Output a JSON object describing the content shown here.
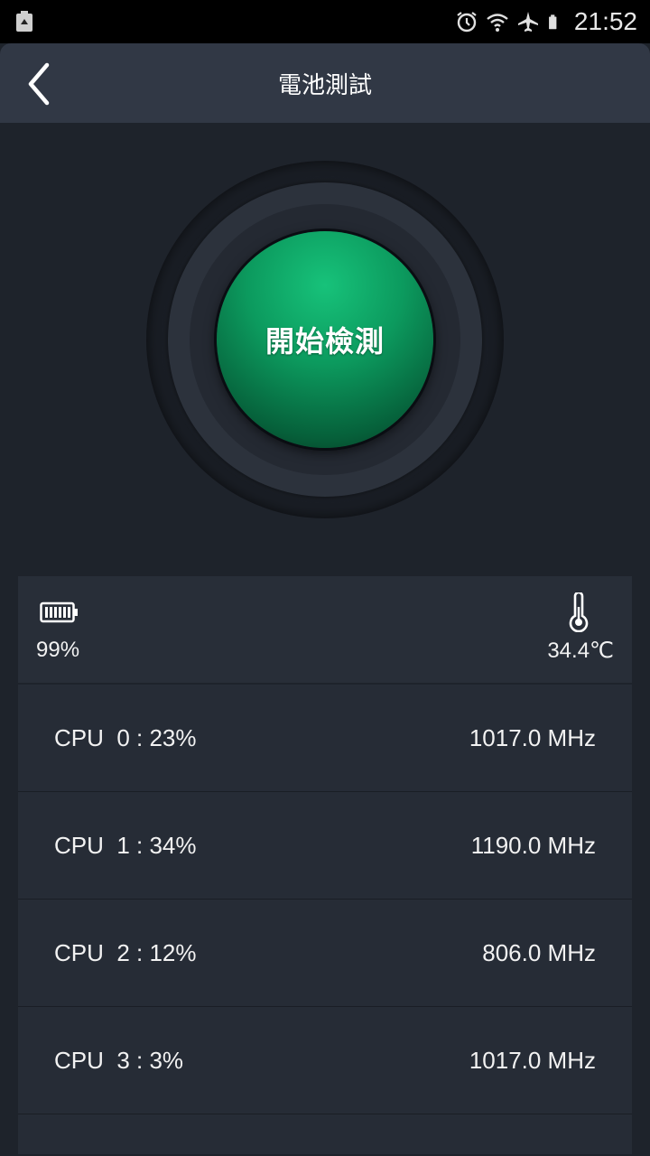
{
  "status_bar": {
    "time": "21:52",
    "icons": [
      "recycle-icon",
      "alarm-icon",
      "wifi-icon",
      "airplane-icon",
      "battery-icon"
    ]
  },
  "app_bar": {
    "title": "電池測試",
    "back_icon": "chevron-left-icon"
  },
  "start_button": {
    "label": "開始檢測",
    "color": "#0c9a5e"
  },
  "info": {
    "battery_level": "99%",
    "battery_icon": "battery-icon",
    "temperature": "34.4℃",
    "thermometer_icon": "thermometer-icon"
  },
  "cpus": [
    {
      "label": "CPU  0 : 23%",
      "freq": "1017.0 MHz"
    },
    {
      "label": "CPU  1 : 34%",
      "freq": "1190.0 MHz"
    },
    {
      "label": "CPU  2 : 12%",
      "freq": "806.0 MHz"
    },
    {
      "label": "CPU  3 : 3%",
      "freq": "1017.0 MHz"
    }
  ],
  "colors": {
    "background": "#1e232b",
    "app_bar": "#313845",
    "panel": "#282e38",
    "accent_green": "#0c9a5e"
  }
}
